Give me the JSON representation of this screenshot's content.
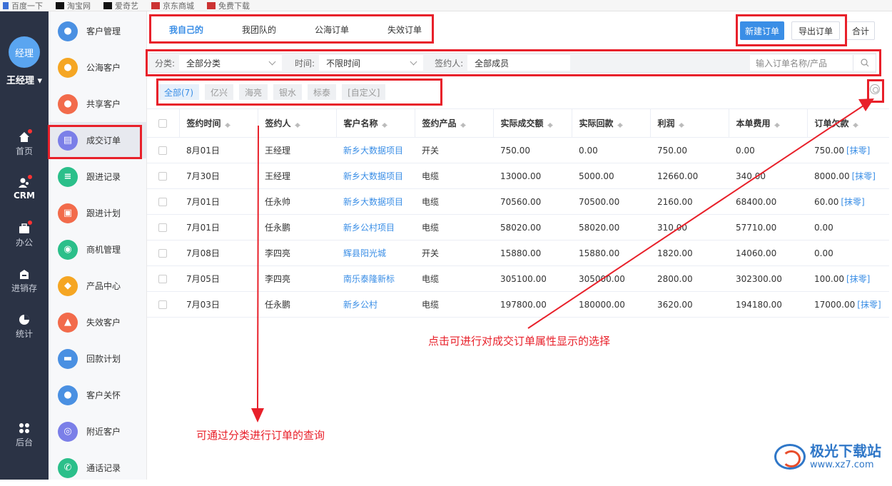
{
  "bookmarks": [
    "百度一下",
    "淘宝网",
    "爱奇艺",
    "京东商城",
    "免费下载"
  ],
  "nav": {
    "avatar_text": "经理",
    "user_name": "王经理",
    "items": [
      {
        "label": "首页",
        "icon": "home-icon"
      },
      {
        "label": "CRM",
        "icon": "crm-icon"
      },
      {
        "label": "办公",
        "icon": "briefcase-icon"
      },
      {
        "label": "进销存",
        "icon": "warehouse-icon"
      },
      {
        "label": "统计",
        "icon": "pie-chart-icon"
      },
      {
        "label": "后台",
        "icon": "grid-icon"
      }
    ]
  },
  "submenu": [
    {
      "label": "客户管理",
      "color": "#4a90e2"
    },
    {
      "label": "公海客户",
      "color": "#f5a623"
    },
    {
      "label": "共享客户",
      "color": "#f26b4b"
    },
    {
      "label": "成交订单",
      "color": "#7b7fe8"
    },
    {
      "label": "跟进记录",
      "color": "#2bbf8a"
    },
    {
      "label": "跟进计划",
      "color": "#f26b4b"
    },
    {
      "label": "商机管理",
      "color": "#2bbf8a"
    },
    {
      "label": "产品中心",
      "color": "#f5a623"
    },
    {
      "label": "失效客户",
      "color": "#f26b4b"
    },
    {
      "label": "回款计划",
      "color": "#4a90e2"
    },
    {
      "label": "客户关怀",
      "color": "#4a90e2"
    },
    {
      "label": "附近客户",
      "color": "#7b7fe8"
    },
    {
      "label": "通话记录",
      "color": "#2bbf8a"
    }
  ],
  "tabs": [
    "我自己的",
    "我团队的",
    "公海订单",
    "失效订单"
  ],
  "actions": {
    "new": "新建订单",
    "export": "导出订单",
    "total": "合计"
  },
  "filter": {
    "category_label": "分类:",
    "category_value": "全部分类",
    "time_label": "时间:",
    "time_value": "不限时间",
    "signer_label": "签约人:",
    "signer_value": "全部成员",
    "search_placeholder": "输入订单名称/产品"
  },
  "chips": [
    "全部(7)",
    "亿兴",
    "海亮",
    "银水",
    "标泰",
    "[自定义]"
  ],
  "table": {
    "columns": [
      "签约时间",
      "签约人",
      "客户名称",
      "签约产品",
      "实际成交额",
      "实际回款",
      "利润",
      "本单费用",
      "订单欠款"
    ],
    "rows": [
      [
        "8月01日",
        "王经理",
        "新乡大数据项目",
        "开关",
        "750.00",
        "0.00",
        "750.00",
        "0.00",
        "750.00",
        "[抹零]"
      ],
      [
        "7月30日",
        "王经理",
        "新乡大数据项目",
        "电缆",
        "13000.00",
        "5000.00",
        "12660.00",
        "340.00",
        "8000.00",
        "[抹零]"
      ],
      [
        "7月01日",
        "任永帅",
        "新乡大数据项目",
        "电缆",
        "70560.00",
        "70500.00",
        "2160.00",
        "68400.00",
        "60.00",
        "[抹零]"
      ],
      [
        "7月01日",
        "任永鹏",
        "新乡公村项目",
        "电缆",
        "58020.00",
        "58020.00",
        "310.00",
        "57710.00",
        "0.00",
        ""
      ],
      [
        "7月08日",
        "李四亮",
        "辉县阳光城",
        "开关",
        "15880.00",
        "15880.00",
        "1820.00",
        "14060.00",
        "0.00",
        ""
      ],
      [
        "7月05日",
        "李四亮",
        "南乐泰隆新标",
        "电缆",
        "305100.00",
        "305000.00",
        "2800.00",
        "302300.00",
        "100.00",
        "[抹零]"
      ],
      [
        "7月03日",
        "任永鹏",
        "新乡公村",
        "电缆",
        "197800.00",
        "180000.00",
        "3620.00",
        "194180.00",
        "17000.00",
        "[抹零]"
      ]
    ]
  },
  "annotations": {
    "category_note": "可通过分类进行订单的查询",
    "settings_note": "点击可进行对成交订单属性显示的选择"
  },
  "watermark": {
    "title": "极光下载站",
    "url": "www.xz7.com"
  }
}
